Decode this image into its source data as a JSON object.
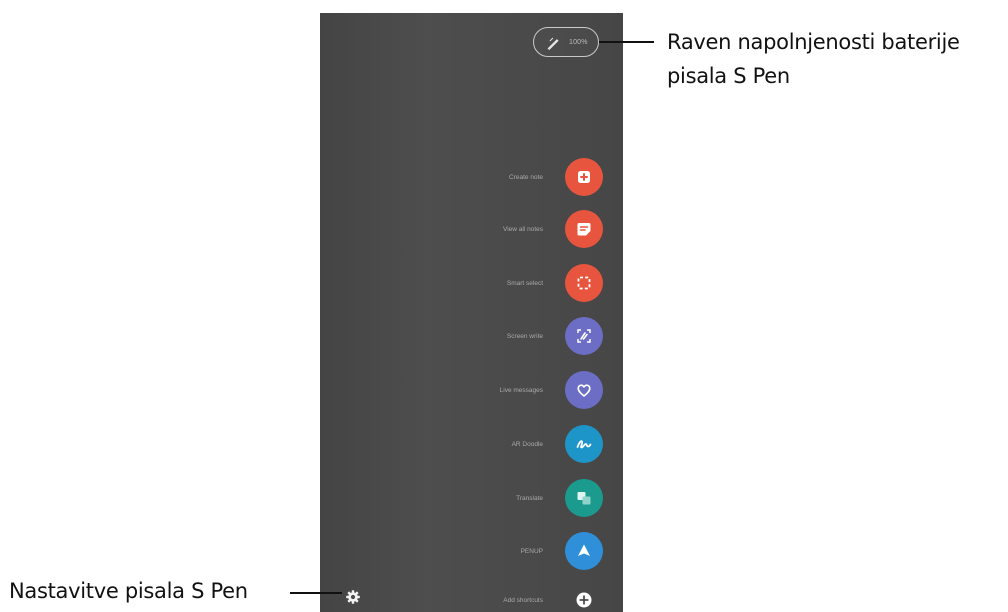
{
  "screen": {
    "battery": {
      "icon": "s-pen-icon",
      "percent_text": "100%"
    },
    "menu_items": [
      {
        "label": "Create note",
        "icon": "create-note-icon",
        "color": "#e8553e"
      },
      {
        "label": "View all notes",
        "icon": "view-notes-icon",
        "color": "#e8553e"
      },
      {
        "label": "Smart select",
        "icon": "smart-select-icon",
        "color": "#e8553e"
      },
      {
        "label": "Screen write",
        "icon": "screen-write-icon",
        "color": "#6b6ec4"
      },
      {
        "label": "Live messages",
        "icon": "live-messages-icon",
        "color": "#6b6ec4"
      },
      {
        "label": "AR Doodle",
        "icon": "ar-doodle-icon",
        "color": "#1e95c8"
      },
      {
        "label": "Translate",
        "icon": "translate-icon",
        "color": "#1a9b8e"
      },
      {
        "label": "PENUP",
        "icon": "penup-icon",
        "color": "#2f8fd8"
      },
      {
        "label": "Add shortcuts",
        "icon": "plus-icon",
        "color": "#ffffff"
      }
    ],
    "settings_icon": "gear-icon"
  },
  "callouts": {
    "battery_line1": "Raven napolnjenosti baterije",
    "battery_line2": "pisala S Pen",
    "settings": "Nastavitve pisala S Pen"
  },
  "colors": {
    "panel": "#4a4a4a",
    "callout_text": "#111111"
  }
}
